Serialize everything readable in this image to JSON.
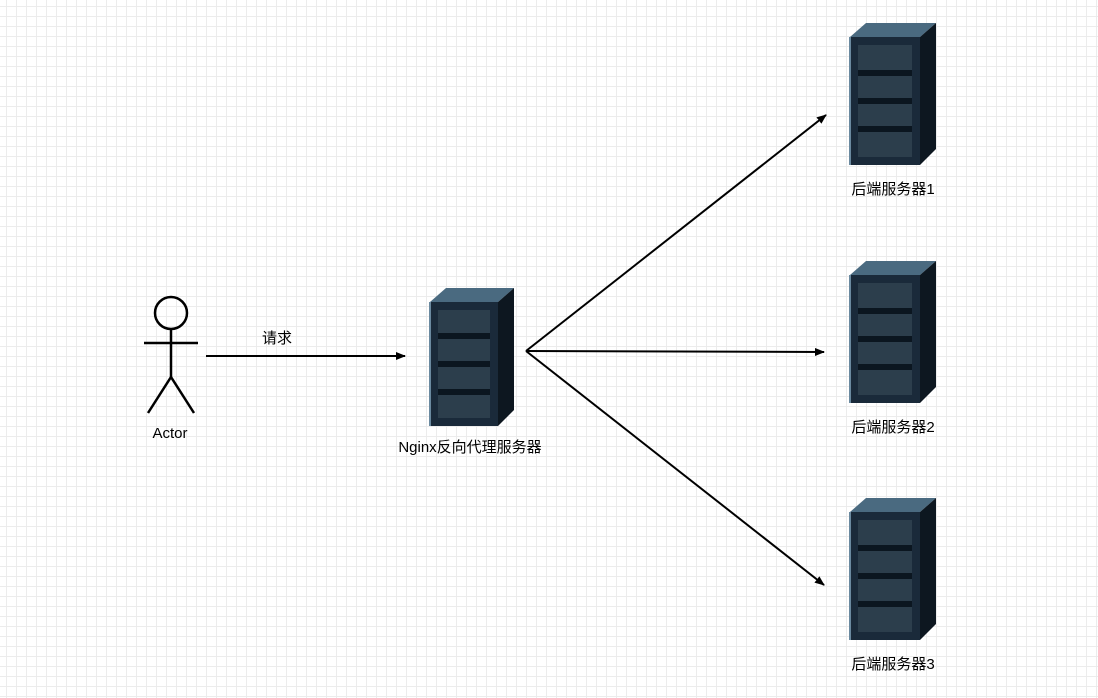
{
  "actor": {
    "label": "Actor"
  },
  "request": {
    "label": "请求"
  },
  "nginx": {
    "label": "Nginx反向代理服务器"
  },
  "backend1": {
    "label": "后端服务器1"
  },
  "backend2": {
    "label": "后端服务器2"
  },
  "backend3": {
    "label": "后端服务器3"
  }
}
